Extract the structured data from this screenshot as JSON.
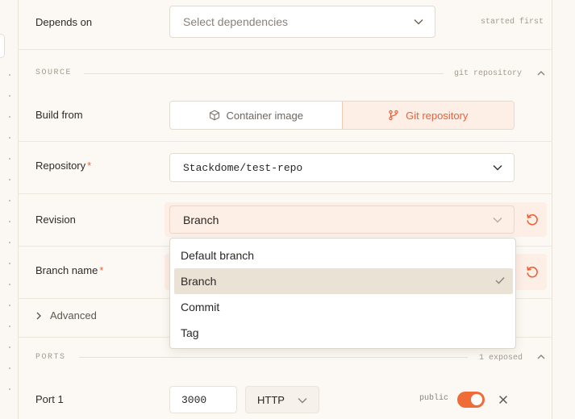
{
  "depends_on": {
    "label": "Depends on",
    "placeholder": "Select dependencies",
    "hint": "started first"
  },
  "source": {
    "title": "SOURCE",
    "hint": "git repository",
    "build_from": {
      "label": "Build from",
      "options": [
        "Container image",
        "Git repository"
      ],
      "active": "Git repository"
    },
    "repository": {
      "label": "Repository",
      "required": "*",
      "value": "Stackdome/test-repo"
    },
    "revision": {
      "label": "Revision",
      "value": "Branch",
      "dropdown": {
        "options": [
          "Default branch",
          "Branch",
          "Commit",
          "Tag"
        ],
        "selected": "Branch"
      }
    },
    "branch_name": {
      "label": "Branch name",
      "required": "*"
    },
    "advanced_label": "Advanced"
  },
  "ports": {
    "title": "PORTS",
    "hint": "1 exposed",
    "port1": {
      "label": "Port 1",
      "value": "3000",
      "protocol": "HTTP",
      "visibility_label": "public",
      "public_enabled": true
    }
  },
  "colors": {
    "accent": "#e8623a",
    "accent_bg": "#fdeee6",
    "selected_option_bg": "#ebe2d6",
    "toggle_on": "#ef6b38"
  }
}
